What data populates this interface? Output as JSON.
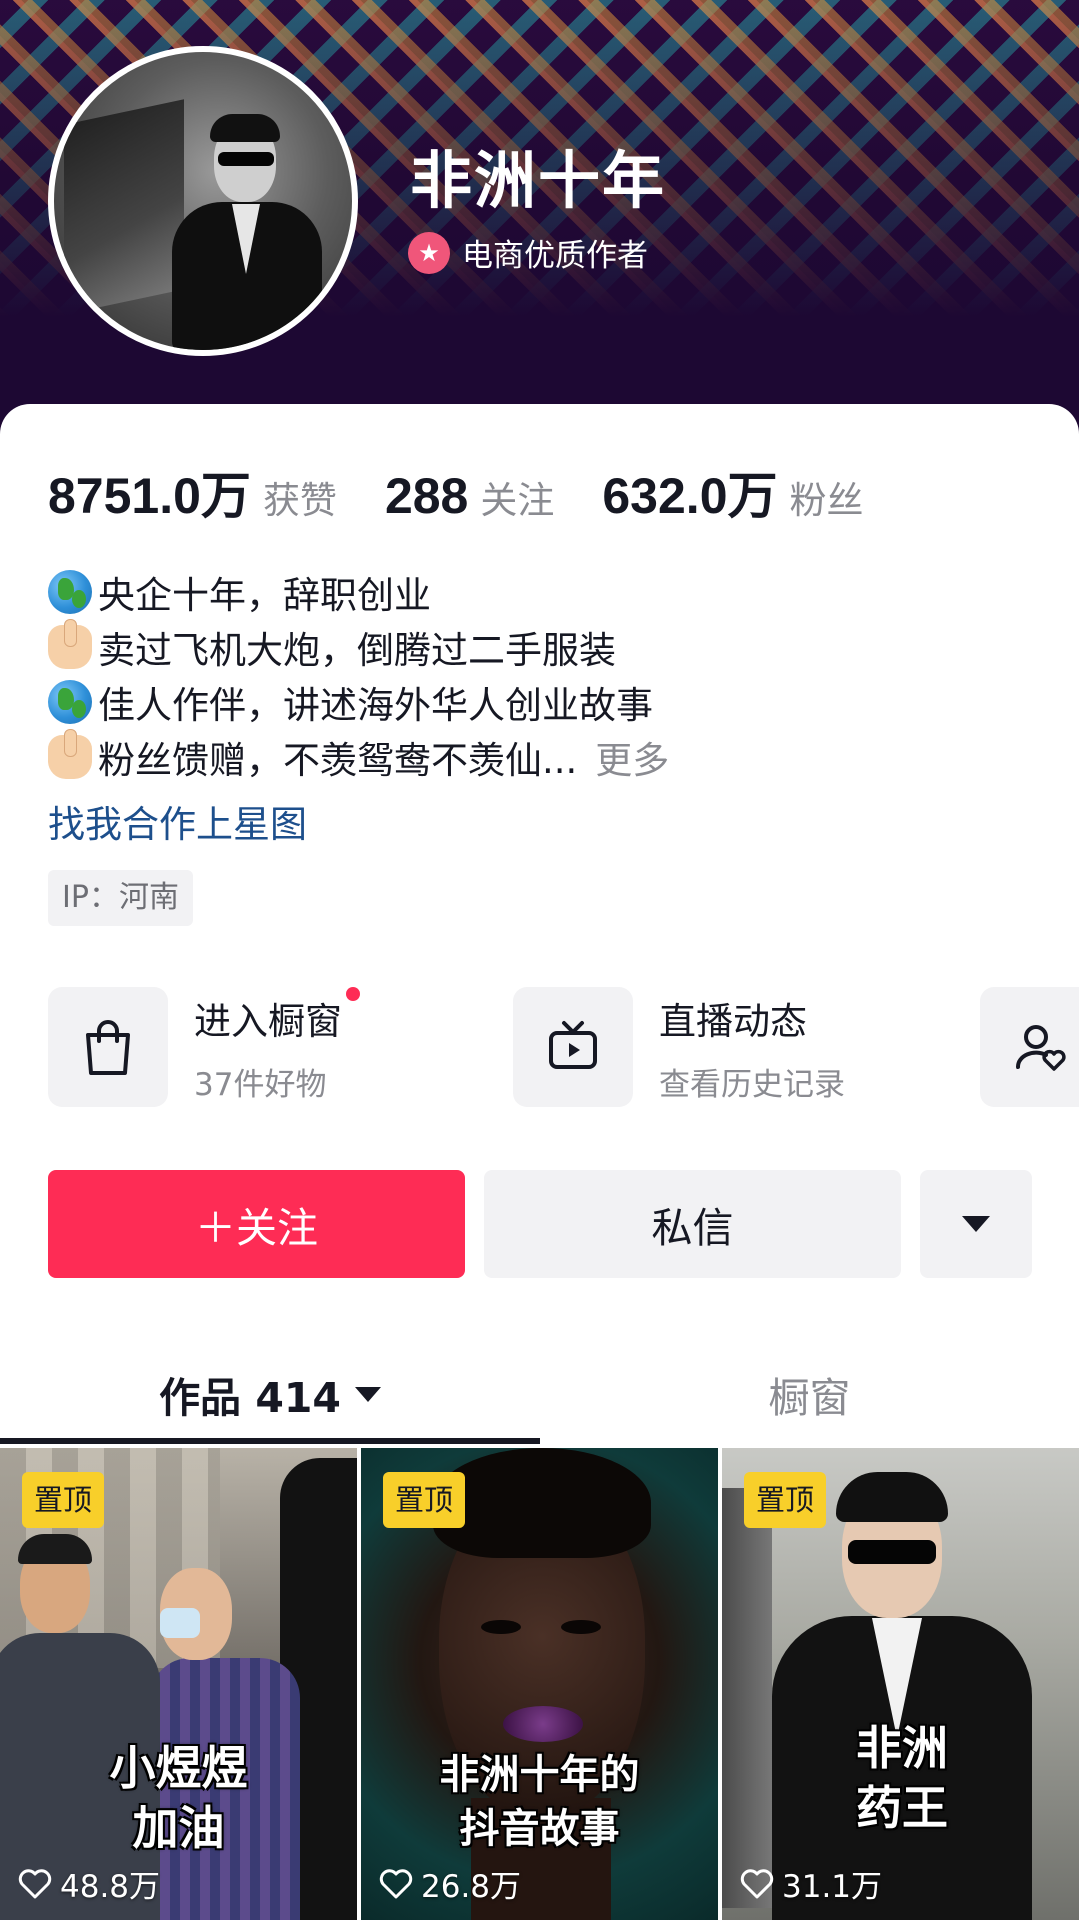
{
  "profile": {
    "nickname": "非洲十年",
    "badge": "电商优质作者",
    "avatar_icon": "avatar-photo"
  },
  "stats": [
    {
      "value": "8751.0万",
      "label": "获赞"
    },
    {
      "value": "288",
      "label": "关注"
    },
    {
      "value": "632.0万",
      "label": "粉丝"
    }
  ],
  "bio": {
    "lines": [
      {
        "icon": "globe-emoji",
        "text": "央企十年，辞职创业"
      },
      {
        "icon": "pointing-hand-emoji",
        "text": "卖过飞机大炮，倒腾过二手服装"
      },
      {
        "icon": "globe-emoji",
        "text": "佳人作伴，讲述海外华人创业故事"
      },
      {
        "icon": "pointing-hand-emoji",
        "text": "粉丝馈赠，不羡鸳鸯不羡仙..."
      }
    ],
    "more": "更多",
    "link": "找我合作上星图",
    "ip": "IP：河南"
  },
  "entries": [
    {
      "icon": "shopping-bag-icon",
      "title": "进入橱窗",
      "subtitle": "37件好物",
      "has_dot": true
    },
    {
      "icon": "tv-icon",
      "title": "直播动态",
      "subtitle": "查看历史记录"
    },
    {
      "icon": "user-heart-icon"
    }
  ],
  "actions": {
    "follow": "＋关注",
    "message": "私信",
    "more_icon": "caret-down-icon"
  },
  "tabs": {
    "works": "作品 414",
    "window": "橱窗"
  },
  "videos": [
    {
      "pin": "置顶",
      "caption_lines": [
        "小煜煜",
        "加油"
      ],
      "likes": "48.8万"
    },
    {
      "pin": "置顶",
      "caption_lines": [
        "非洲十年的",
        "抖音故事"
      ],
      "likes": "26.8万"
    },
    {
      "pin": "置顶",
      "caption_lines": [
        "非洲",
        "药王"
      ],
      "likes": "31.1万"
    }
  ],
  "colors": {
    "accent": "#fe2c55",
    "pin": "#f8cf2a",
    "link": "#1d4f8c",
    "banner": "#1d0833"
  }
}
